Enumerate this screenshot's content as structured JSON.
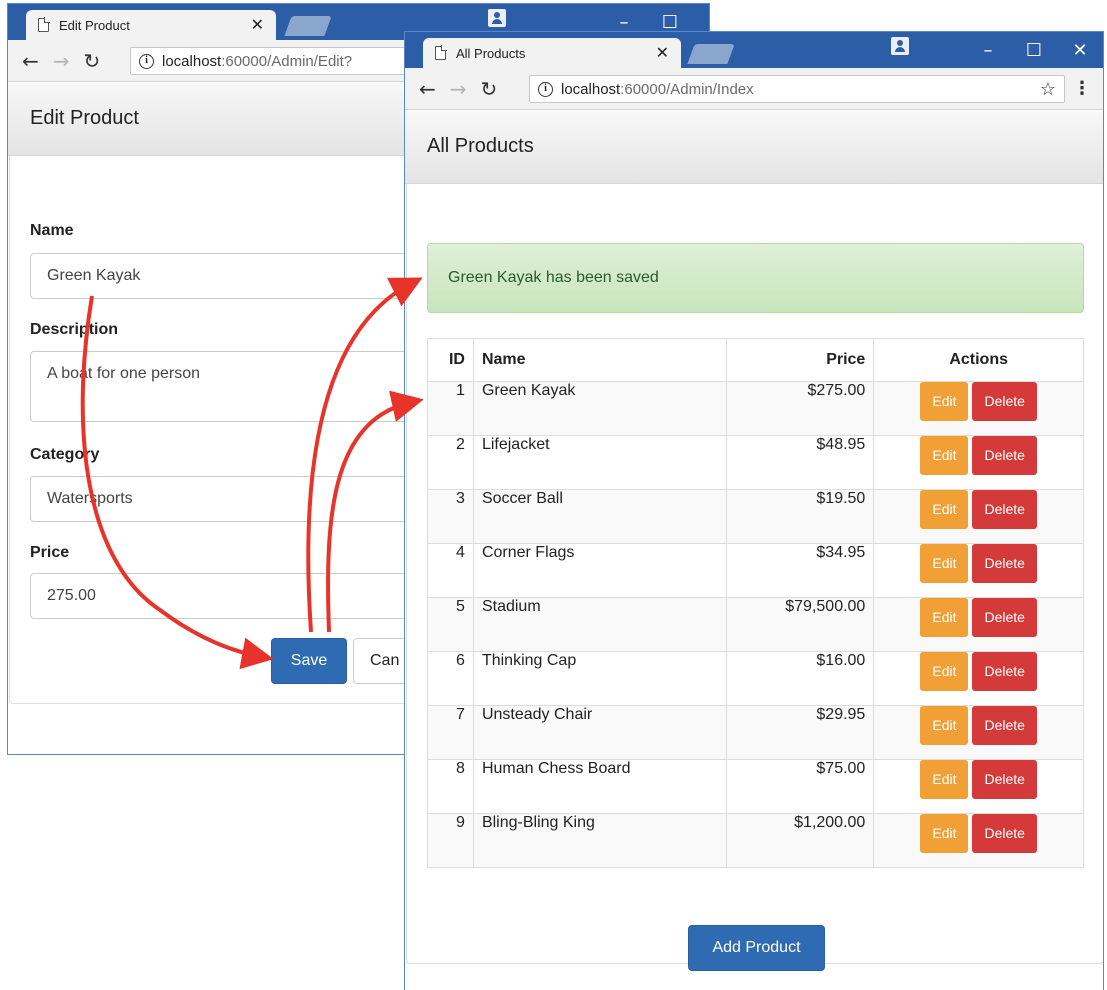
{
  "edit_window": {
    "tab_title": "Edit Product",
    "url_host": "localhost",
    "url_path": ":60000/Admin/Edit?",
    "header_title": "Edit Product",
    "form": {
      "name_label": "Name",
      "name_value": "Green Kayak",
      "description_label": "Description",
      "description_value": "A boat for one person",
      "category_label": "Category",
      "category_value": "Watersports",
      "price_label": "Price",
      "price_value": "275.00",
      "save_label": "Save",
      "cancel_label": "Can"
    }
  },
  "index_window": {
    "tab_title": "All Products",
    "url_host": "localhost",
    "url_path": ":60000/Admin/Index",
    "header_title": "All Products",
    "alert_text": "Green Kayak has been saved",
    "table": {
      "headers": {
        "id": "ID",
        "name": "Name",
        "price": "Price",
        "actions": "Actions"
      },
      "rows": [
        {
          "id": "1",
          "name": "Green Kayak",
          "price": "$275.00"
        },
        {
          "id": "2",
          "name": "Lifejacket",
          "price": "$48.95"
        },
        {
          "id": "3",
          "name": "Soccer Ball",
          "price": "$19.50"
        },
        {
          "id": "4",
          "name": "Corner Flags",
          "price": "$34.95"
        },
        {
          "id": "5",
          "name": "Stadium",
          "price": "$79,500.00"
        },
        {
          "id": "6",
          "name": "Thinking Cap",
          "price": "$16.00"
        },
        {
          "id": "7",
          "name": "Unsteady Chair",
          "price": "$29.95"
        },
        {
          "id": "8",
          "name": "Human Chess Board",
          "price": "$75.00"
        },
        {
          "id": "9",
          "name": "Bling-Bling King",
          "price": "$1,200.00"
        }
      ],
      "edit_label": "Edit",
      "delete_label": "Delete"
    },
    "add_button_label": "Add Product"
  },
  "icons": {
    "tab_close": "close-icon",
    "back": "back-arrow-icon",
    "forward": "forward-arrow-icon",
    "reload": "reload-icon",
    "info": "info-icon",
    "bookmark": "star-icon",
    "menu": "kebab-menu-icon",
    "user": "user-icon",
    "minimize": "minimize-icon",
    "maximize": "maximize-icon",
    "close_window": "close-window-icon"
  },
  "colors": {
    "titlebar": "#2b5ea7",
    "primary_button": "#2f6bb3",
    "edit_button": "#f0a034",
    "delete_button": "#d43a3a",
    "alert_bg": "#dff0d8",
    "arrow": "#e8332a"
  }
}
